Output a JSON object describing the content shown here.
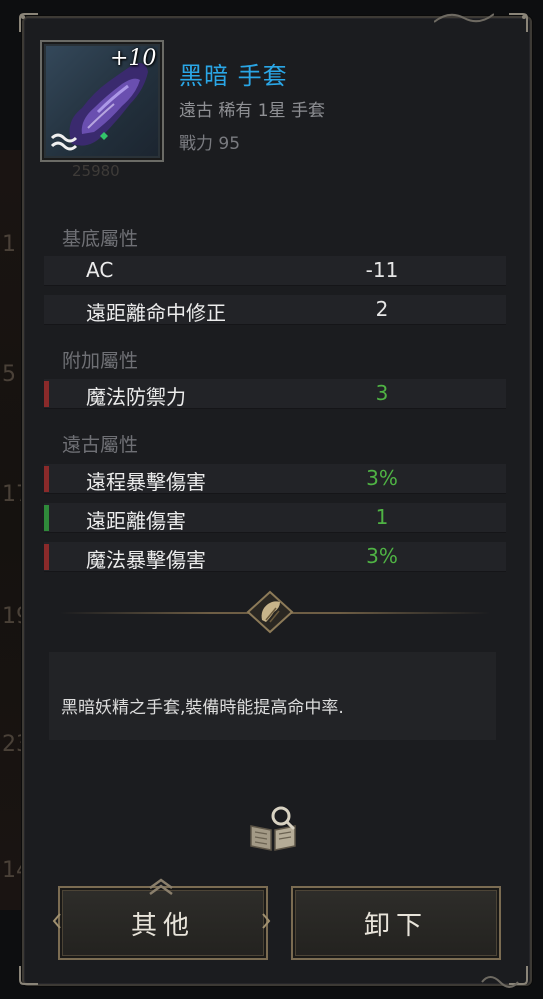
{
  "background": {
    "numbers": [
      "1",
      "5",
      "17",
      "19",
      "23",
      "14"
    ]
  },
  "item": {
    "enchant": "+10",
    "sub_value": "25980",
    "name": "黑暗 手套",
    "type": "遠古 稀有 1星 手套",
    "power": "戰力 95"
  },
  "sections": {
    "base": {
      "title": "基底屬性",
      "stats": [
        {
          "name": "AC",
          "value": "-11"
        },
        {
          "name": "遠距離命中修正",
          "value": "2"
        }
      ]
    },
    "extra": {
      "title": "附加屬性",
      "stats": [
        {
          "name": "魔法防禦力",
          "value": "3",
          "bar_color": "#8a2a2a"
        }
      ]
    },
    "ancient": {
      "title": "遠古屬性",
      "stats": [
        {
          "name": "遠程暴擊傷害",
          "value": "3%",
          "bar_color": "#8a2a2a"
        },
        {
          "name": "遠距離傷害",
          "value": "1",
          "bar_color": "#2f8a3a"
        },
        {
          "name": "魔法暴擊傷害",
          "value": "3%",
          "bar_color": "#8a2a2a"
        }
      ]
    }
  },
  "description": "黑暗妖精之手套,裝備時能提高命中率.",
  "buttons": {
    "other": "其他",
    "unequip": "卸下"
  },
  "colors": {
    "name": "#2aa6e6",
    "green_value": "#4fb344",
    "panel": "#1b1c1f",
    "button_border": "#7b6c52"
  }
}
